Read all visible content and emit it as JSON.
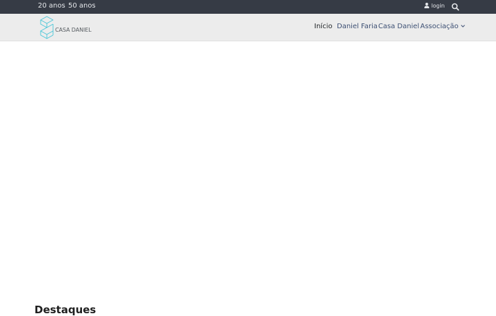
{
  "topbar": {
    "links": [
      "20 anos",
      "50 anos"
    ],
    "login_label": "login",
    "login_icon": "user-icon",
    "search_icon": "search-icon"
  },
  "brand": {
    "logo_icon": "casa-daniel-logo-mark",
    "name": "CASA DANIEL",
    "accent_color": "#46c6d8"
  },
  "nav": {
    "items": [
      "Início",
      "Daniel Faria",
      "Casa Daniel",
      "Associação"
    ],
    "active": "Início",
    "dropdown_icon": "chevron-down-icon"
  },
  "main": {
    "section_title": "Destaques"
  },
  "colors": {
    "topbar_bg": "#363b45",
    "navbar_bg": "#ececec",
    "nav_link": "#3c4f73"
  }
}
